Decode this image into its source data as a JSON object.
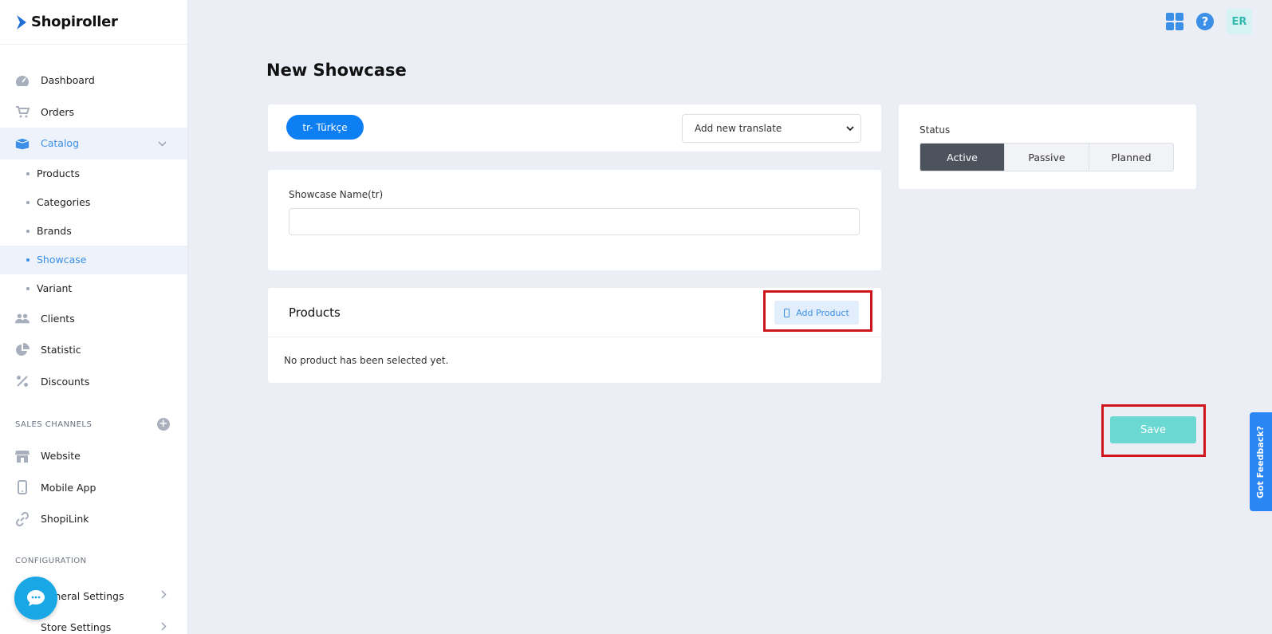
{
  "app": {
    "logo_text": "Shopiroller"
  },
  "sidebar": {
    "main_items": [
      {
        "label": "Dashboard",
        "icon": "gauge-icon"
      },
      {
        "label": "Orders",
        "icon": "cart-icon"
      },
      {
        "label": "Catalog",
        "icon": "box-icon"
      }
    ],
    "catalog_sub": [
      {
        "label": "Products"
      },
      {
        "label": "Categories"
      },
      {
        "label": "Brands"
      },
      {
        "label": "Showcase"
      },
      {
        "label": "Variant"
      }
    ],
    "more_items": [
      {
        "label": "Clients",
        "icon": "users-icon"
      },
      {
        "label": "Statistic",
        "icon": "pie-chart-icon"
      },
      {
        "label": "Discounts",
        "icon": "percent-icon"
      }
    ],
    "sales_channels_title": "SALES CHANNELS",
    "sales_channels": [
      {
        "label": "Website",
        "icon": "store-icon"
      },
      {
        "label": "Mobile App",
        "icon": "mobile-icon"
      },
      {
        "label": "ShopiLink",
        "icon": "link-icon"
      }
    ],
    "configuration_title": "CONFIGURATION",
    "configuration": [
      {
        "label": "General Settings"
      },
      {
        "label": "Store Settings"
      }
    ]
  },
  "header": {
    "avatar_initials": "ER"
  },
  "page": {
    "title": "New Showcase",
    "language_button": "tr- Türkçe",
    "translate_select": "Add new translate",
    "name_label": "Showcase Name(tr)",
    "name_value": "",
    "products_title": "Products",
    "add_product_label": "Add Product",
    "empty_products": "No product has been selected yet.",
    "status_label": "Status",
    "status_options": [
      "Active",
      "Passive",
      "Planned"
    ],
    "status_selected": "Active",
    "save_label": "Save",
    "feedback_label": "Got Feedback?"
  },
  "colors": {
    "primary": "#0d7ff2",
    "accent": "#3b8fe6",
    "save": "#6bd8d2",
    "highlight": "#d0141c",
    "status_active": "#4c535c"
  }
}
